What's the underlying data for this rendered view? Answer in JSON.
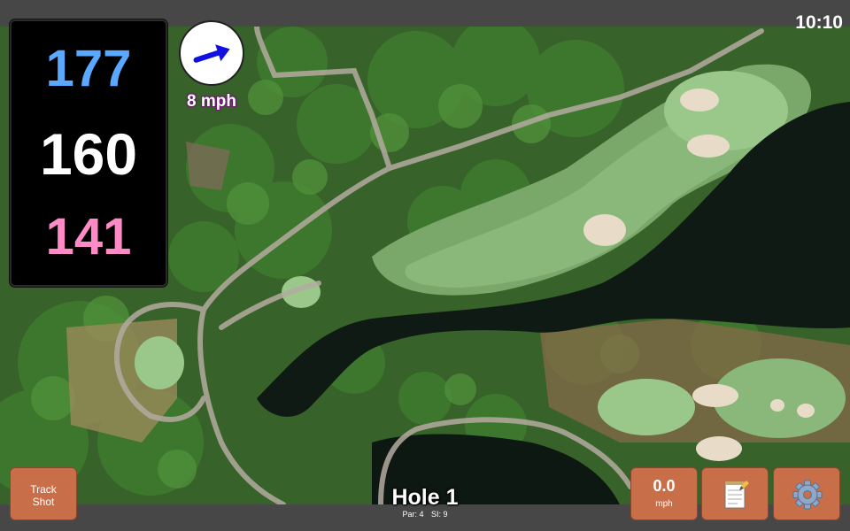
{
  "clock": "10:10",
  "distances": {
    "back": "177",
    "middle": "160",
    "front": "141",
    "back_color": "#5aa8ff",
    "middle_color": "#ffffff",
    "front_color": "#ff8ac6"
  },
  "wind": {
    "speed_label": "8 mph",
    "arrow_icon": "wind-arrow-icon",
    "arrow_color": "#1010e0"
  },
  "buttons": {
    "track_shot_line1": "Track",
    "track_shot_line2": "Shot",
    "speed_value": "0.0",
    "speed_unit": "mph",
    "notes_icon": "notepad-icon",
    "settings_icon": "gear-icon",
    "button_color": "#c86f4a"
  },
  "hole": {
    "title": "Hole 1",
    "par": "Par: 4",
    "si": "SI: 9"
  }
}
